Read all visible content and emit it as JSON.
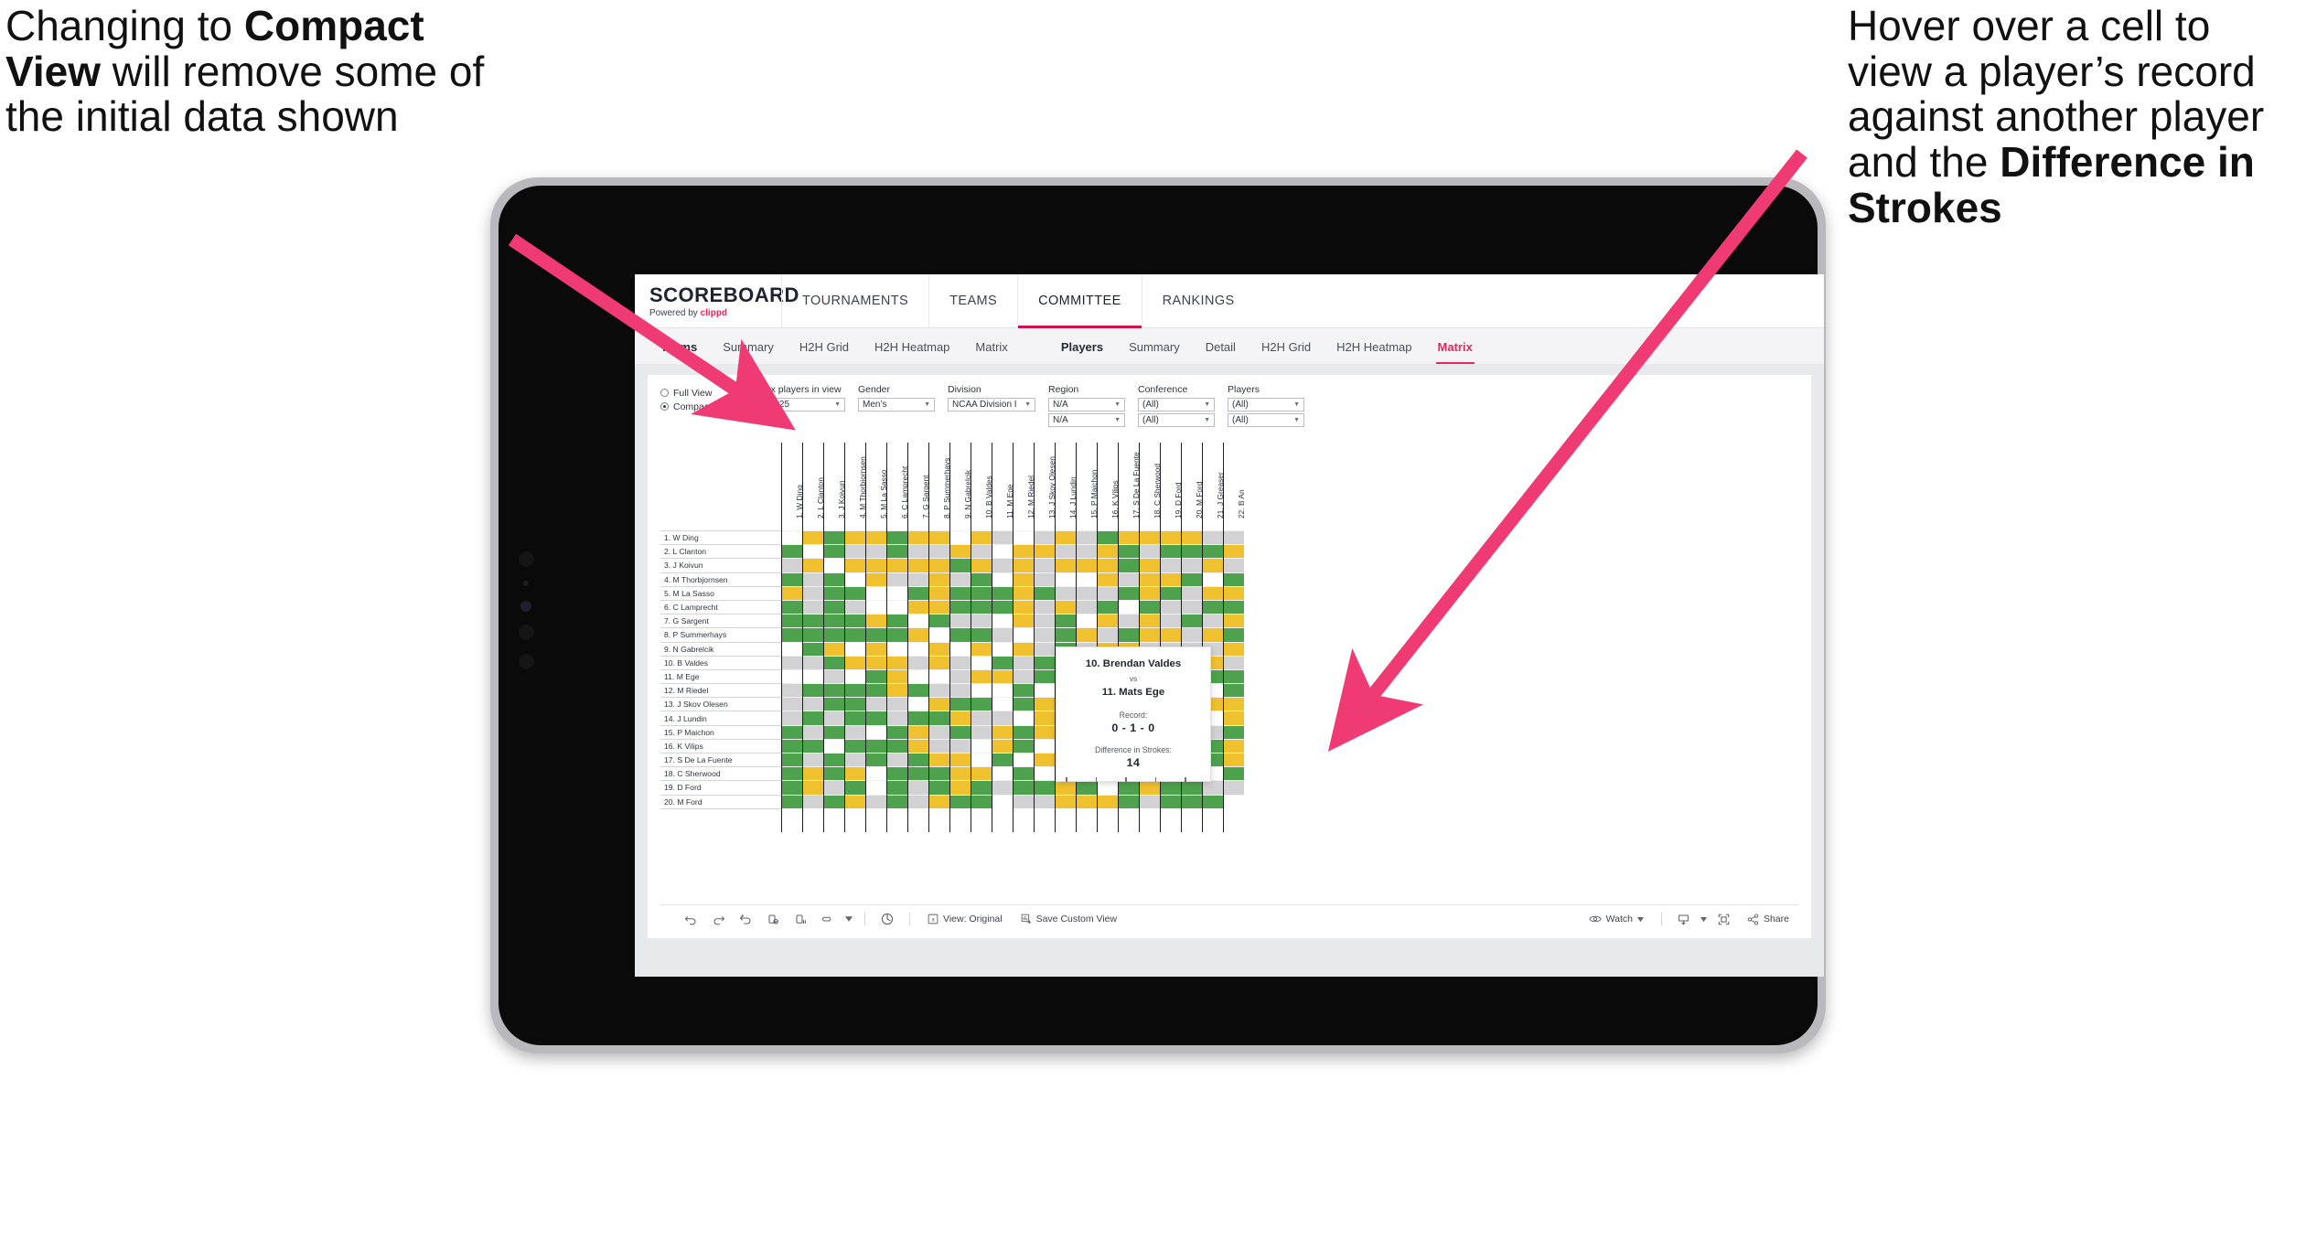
{
  "annotations": {
    "left": {
      "pre": "Changing to ",
      "bold": "Compact View",
      "post": " will remove some of the initial data shown"
    },
    "right": {
      "pre": "Hover over a cell to view a player’s record against another player and the ",
      "bold": "Difference in Strokes",
      "post": ""
    },
    "arrow_color": "#EF3A74"
  },
  "app": {
    "brand": {
      "title": "SCOREBOARD",
      "sub_pre": "Powered by ",
      "sub_brand": "clippd"
    },
    "top_nav": [
      {
        "label": "TOURNAMENTS",
        "active": false
      },
      {
        "label": "TEAMS",
        "active": false
      },
      {
        "label": "COMMITTEE",
        "active": true
      },
      {
        "label": "RANKINGS",
        "active": false
      }
    ],
    "sub_nav_left": [
      {
        "label": "Teams",
        "style": "strong"
      },
      {
        "label": "Summary",
        "style": ""
      },
      {
        "label": "H2H Grid",
        "style": ""
      },
      {
        "label": "H2H Heatmap",
        "style": ""
      },
      {
        "label": "Matrix",
        "style": ""
      }
    ],
    "sub_nav_right": [
      {
        "label": "Players",
        "style": "strong"
      },
      {
        "label": "Summary",
        "style": ""
      },
      {
        "label": "Detail",
        "style": ""
      },
      {
        "label": "H2H Grid",
        "style": ""
      },
      {
        "label": "H2H Heatmap",
        "style": ""
      },
      {
        "label": "Matrix",
        "style": "sel"
      }
    ]
  },
  "filters": {
    "view_mode": {
      "full_label": "Full View",
      "compact_label": "Compact View",
      "selected": "Compact View"
    },
    "max_players": {
      "label": "Max players in view",
      "value": "Top 25"
    },
    "gender": {
      "label": "Gender",
      "value": "Men’s"
    },
    "division": {
      "label": "Division",
      "value": "NCAA Division I"
    },
    "region": {
      "label": "Region",
      "value": "N/A",
      "value2": "N/A"
    },
    "conference": {
      "label": "Conference",
      "value": "(All)",
      "value2": "(All)"
    },
    "players": {
      "label": "Players",
      "value": "(All)",
      "value2": "(All)"
    }
  },
  "matrix": {
    "row_labels": [
      "1. W Ding",
      "2. L Clanton",
      "3. J Koivun",
      "4. M Thorbjornsen",
      "5. M La Sasso",
      "6. C Lamprecht",
      "7. G Sargent",
      "8. P Summerhays",
      "9. N Gabrelcik",
      "10. B Valdes",
      "11. M Ege",
      "12. M Riedel",
      "13. J Skov Olesen",
      "14. J Lundin",
      "15. P Maichon",
      "16. K Vilips",
      "17. S De La Fuente",
      "18. C Sherwood",
      "19. D Ford",
      "20. M Ford"
    ],
    "col_labels": [
      "1. W Ding",
      "2. L Clanton",
      "3. J Koivun",
      "4. M Thorbjornsen",
      "5. M La Sasso",
      "6. C Lamprecht",
      "7. G Sargent",
      "8. P Summerhays",
      "9. N Gabrelcik",
      "10. B Valdes",
      "11. M Ege",
      "12. M Riedel",
      "13. J Skov Olesen",
      "14. J Lundin",
      "15. P Maichon",
      "16. K Vilips",
      "17. S De La Fuente",
      "18. C Sherwood",
      "19. D Ford",
      "20. M Ford",
      "21. J Greaser",
      "22. B An"
    ],
    "legend_colors": {
      "win": "#4EA24E",
      "tie": "#F0C12F",
      "loss": "#D2D2D4",
      "none": "#FFFFFF",
      "self": "#FFFFFF"
    },
    "cells": [
      "wygyygyywyawayagyyyyaa",
      "gwgaagaayawyyaaygagggy",
      "aywyyyyygyayayyygyaaya",
      "gagwyaayagwyawwyayygwg",
      "yaggwwgygggygaaagygayy",
      "gagawwyygggyayagwgaagg",
      "ggggygwgaawyagwyayagay",
      "ggggggywggawagyagyyayg",
      "wgywywwywywyagayyaaaay",
      "aagyyyayawgagaayyagaya",
      "wwawgywwayyaggwyyyyagg",
      "aggggygaawwgwyaggggywg",
      "aaggaawyggwgyagaaagayy",
      "agaggaggyaawyagagaygwy",
      "gagawgyagaygyayagggyag",
      "ggwgggyaawygwgyggaaygy",
      "gagagagyywgwyyyygggwgy",
      "gygywgggyywgwgyyyaggwg",
      "gyagwgagygaggygwgyggaa",
      "gagyagayggwaayyygagggw"
    ]
  },
  "tooltip": {
    "player_a": "10. Brendan Valdes",
    "vs": "vs",
    "player_b": "11. Mats Ege",
    "record_label": "Record:",
    "record_value": "0 - 1 - 0",
    "diff_label": "Difference in Strokes:",
    "diff_value": "14"
  },
  "toolbar": {
    "icons": [
      "undo-icon",
      "redo-icon",
      "revert-icon",
      "refresh-data-icon",
      "pause-updates-icon",
      "presentation-mode-icon"
    ],
    "view_label": "View: Original",
    "save_view_label": "Save Custom View",
    "watch_label": "Watch",
    "share_label": "Share"
  }
}
